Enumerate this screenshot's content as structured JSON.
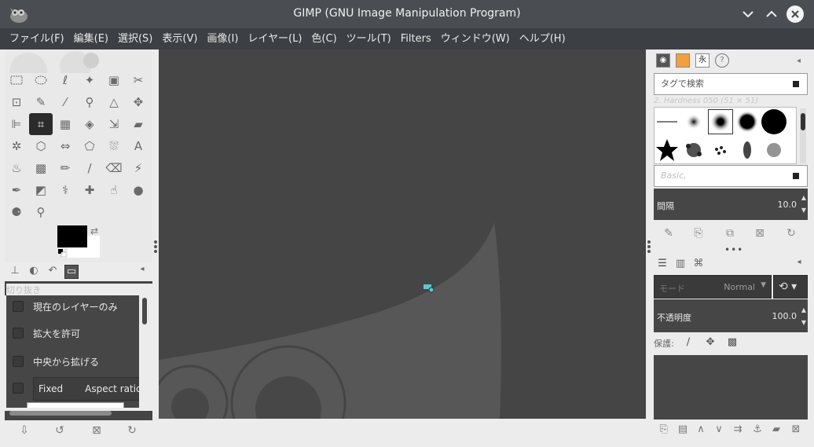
{
  "window": {
    "title": "GIMP (GNU Image Manipulation Program)",
    "minimize_icon": "chevron-down-icon",
    "maximize_icon": "chevron-up-icon",
    "close_icon": "close-icon"
  },
  "menubar": {
    "items": [
      "ファイル(F)",
      "編集(E)",
      "選択(S)",
      "表示(V)",
      "画像(I)",
      "レイヤー(L)",
      "色(C)",
      "ツール(T)",
      "Filters",
      "ウィンドウ(W)",
      "ヘルプ(H)"
    ]
  },
  "toolbox": {
    "tool_options_title": "切り抜き",
    "options": {
      "current_layer_only": "現在のレイヤーのみ",
      "allow_growing": "拡大を許可",
      "expand_from_center": "中央から拡げる",
      "fixed_label": "Fixed",
      "fixed_value": "Aspect ratio"
    }
  },
  "brushes": {
    "search_placeholder": "タグで検索",
    "current_brush": "2. Hardness 050 (51 × 51)",
    "tag_placeholder": "Basic,",
    "spacing_label": "間隔",
    "spacing_value": "10.0"
  },
  "layers": {
    "mode_label": "モード",
    "mode_value": "Normal",
    "opacity_label": "不透明度",
    "opacity_value": "100.0",
    "lock_label": "保護:"
  },
  "colors": {
    "titlebar": "#4a4d52",
    "menubar": "#3c3f43",
    "canvas": "#454545",
    "foreground": "#000000",
    "background": "#ffffff"
  }
}
